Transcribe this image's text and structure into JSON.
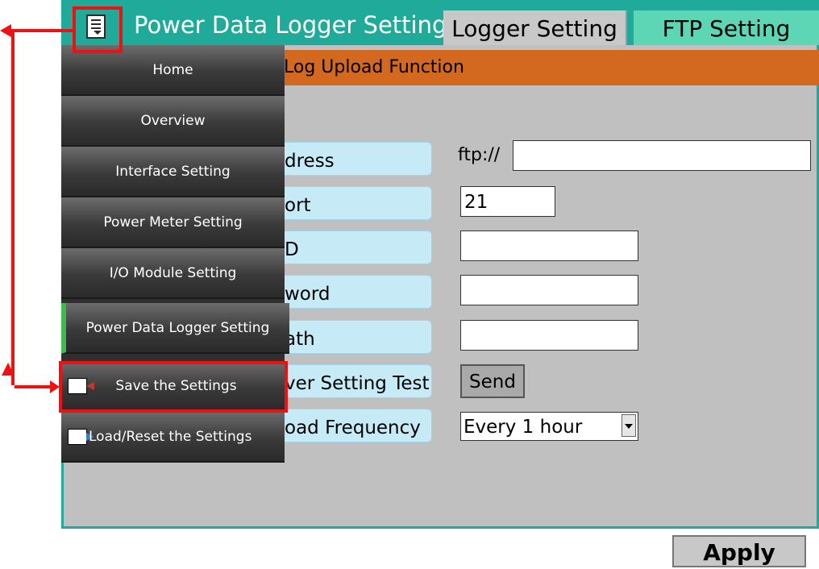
{
  "header": {
    "title": "Power Data Logger Setting",
    "tabs": [
      "Logger Setting",
      "FTP Setting"
    ]
  },
  "section": {
    "title": "Log Upload Function"
  },
  "fields": {
    "address_label": "dress",
    "ftp_prefix": "ftp://",
    "address_value": "",
    "port_label": "ort",
    "port_value": "21",
    "id_label": "D",
    "id_value": "",
    "password_label": "word",
    "password_value": "",
    "path_label": "ath",
    "path_value": "",
    "test_label": "ver Setting Test",
    "send_label": "Send",
    "frequency_label": "oad Frequency",
    "frequency_value": "Every 1 hour"
  },
  "menu": {
    "items": [
      "Home",
      "Overview",
      "Interface Setting",
      "Power Meter Setting",
      "I/O Module Setting",
      "Power Data Logger Setting",
      "Save the Settings",
      "Load/Reset the Settings"
    ],
    "icons": [
      "menu-icon",
      "save-icon",
      "load-icon"
    ]
  },
  "apply_label": "Apply",
  "colors": {
    "header": "#1faa9a",
    "section_bar": "#d2691e",
    "panel": "#c0c0c0",
    "ftp_tab": "#5cd6b4",
    "annotation": "#ee1111",
    "active_marker": "#3fb950"
  }
}
